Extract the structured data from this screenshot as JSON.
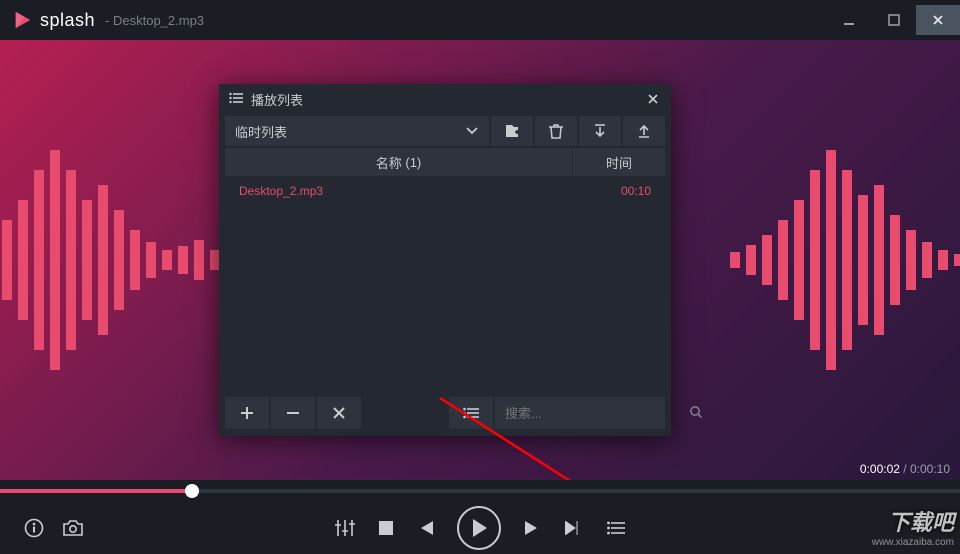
{
  "app": {
    "name": "splash",
    "current_file": "Desktop_2.mp3"
  },
  "playlist": {
    "title": "播放列表",
    "dropdown_selected": "临时列表",
    "columns": {
      "name": "名称",
      "name_count": "(1)",
      "time": "时间"
    },
    "items": [
      {
        "name": "Desktop_2.mp3",
        "time": "00:10"
      }
    ],
    "search_placeholder": "搜索..."
  },
  "playback": {
    "current_time": "0:00:02",
    "total_time": "0:00:10",
    "progress_percent": 20
  },
  "watermark": {
    "brand": "下载吧",
    "url": "www.xiazaiba.com"
  },
  "colors": {
    "accent": "#e94b6e"
  }
}
